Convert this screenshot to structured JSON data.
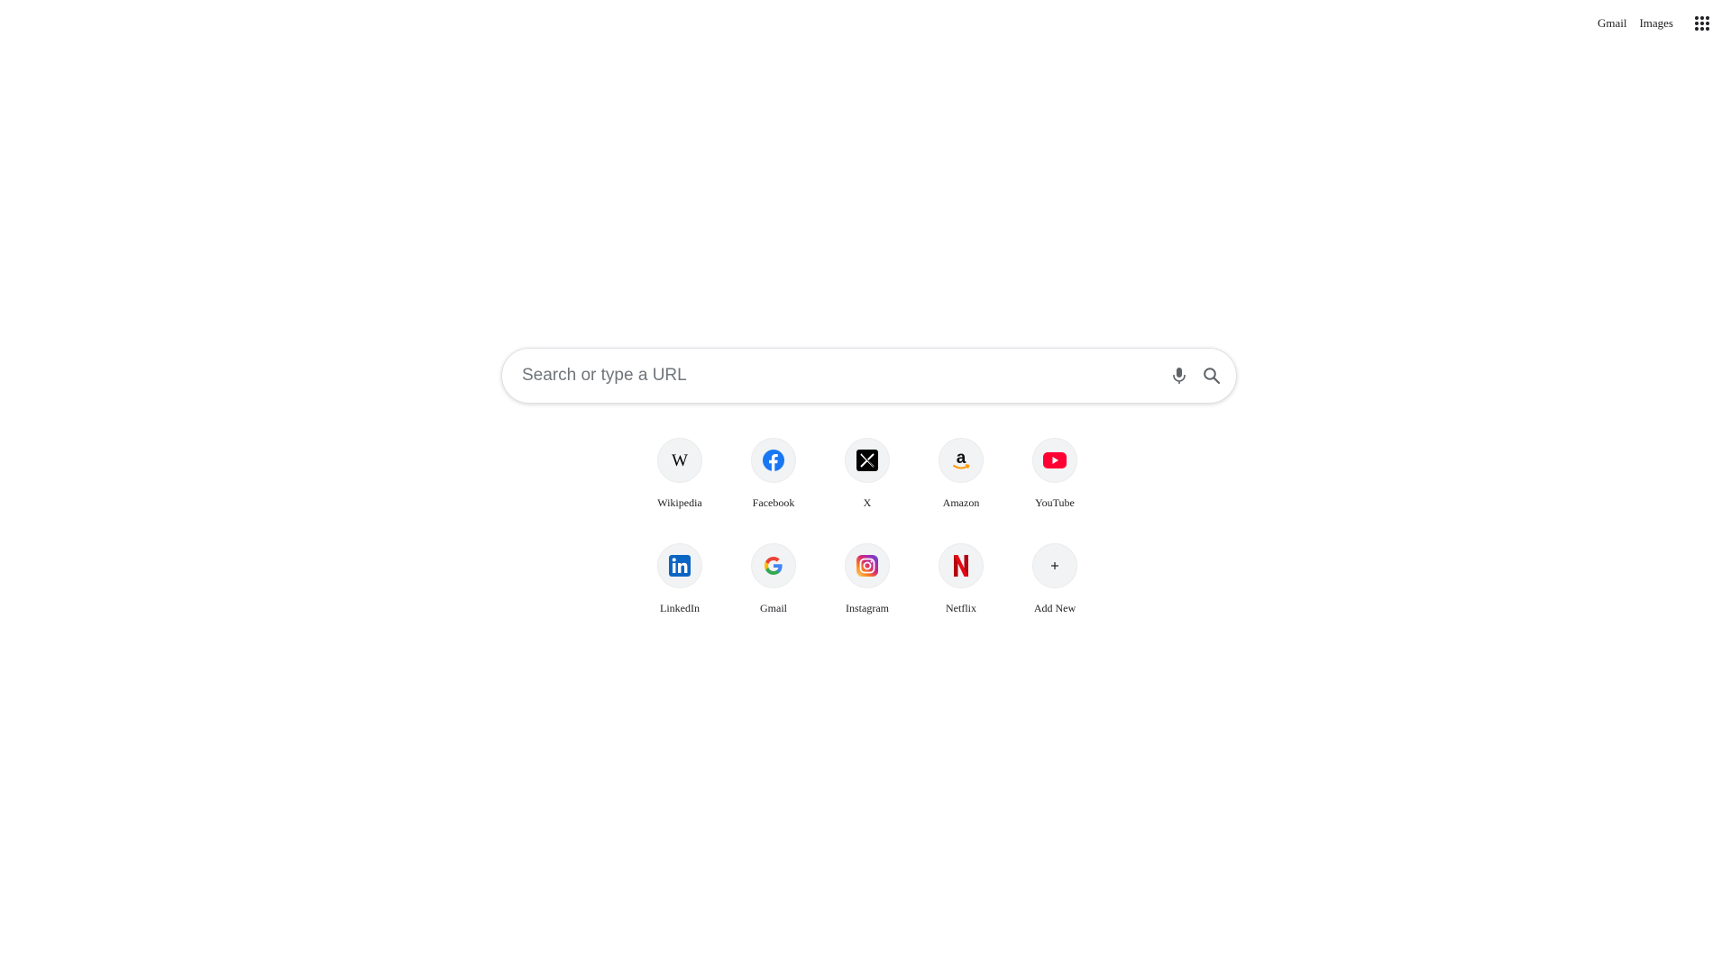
{
  "header": {
    "links": [
      {
        "label": "Gmail"
      },
      {
        "label": "Images"
      }
    ],
    "apps_icon": "apps-grid-icon"
  },
  "search": {
    "placeholder": "Search or type a URL",
    "value": "",
    "mic_icon": "microphone-icon",
    "search_icon": "search-icon"
  },
  "shortcuts": [
    {
      "label": "Wikipedia",
      "icon": "wikipedia-icon"
    },
    {
      "label": "Facebook",
      "icon": "facebook-icon"
    },
    {
      "label": "X",
      "icon": "x-icon"
    },
    {
      "label": "Amazon",
      "icon": "amazon-icon"
    },
    {
      "label": "YouTube",
      "icon": "youtube-icon"
    },
    {
      "label": "LinkedIn",
      "icon": "linkedin-icon"
    },
    {
      "label": "Gmail",
      "icon": "google-icon"
    },
    {
      "label": "Instagram",
      "icon": "instagram-icon"
    },
    {
      "label": "Netflix",
      "icon": "netflix-icon"
    },
    {
      "label": "Add New",
      "icon": "plus-icon"
    }
  ],
  "colors": {
    "facebook": "#1877f2",
    "youtube": "#ff0033",
    "linkedin": "#0a66c2",
    "netflix": "#e50914",
    "amazon_arrow": "#ff9900",
    "text": "#202124",
    "placeholder": "#70757a",
    "tile_bg": "#f1f3f4"
  }
}
